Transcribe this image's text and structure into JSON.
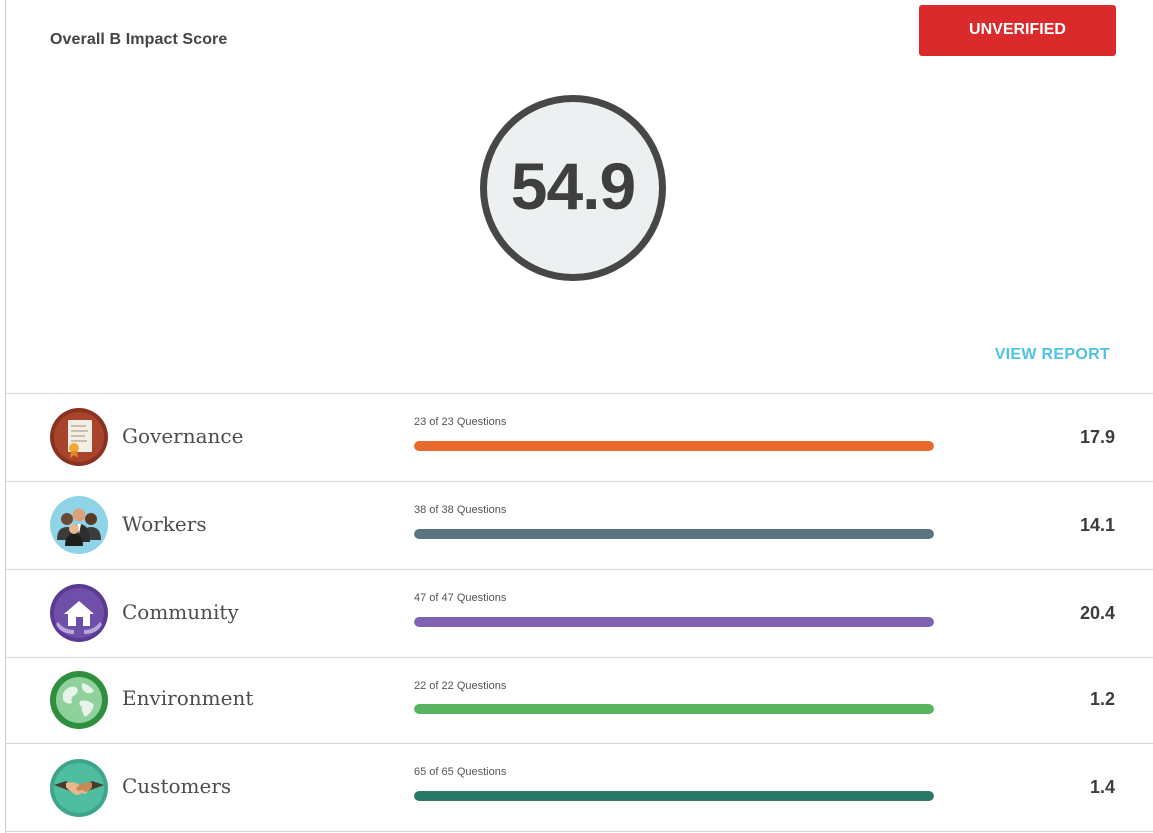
{
  "header": {
    "title": "Overall B Impact Score",
    "status_label": "UNVERIFIED",
    "status_color": "#db2a2c"
  },
  "score": {
    "value": "54.9"
  },
  "actions": {
    "view_report_label": "VIEW REPORT"
  },
  "categories": [
    {
      "name": "Governance",
      "questions": "23 of 23 Questions",
      "score": "17.9",
      "progress": 1.0,
      "bar_color": "#e8692c",
      "icon": "certificate-document-icon",
      "icon_color": "#8a3120"
    },
    {
      "name": "Workers",
      "questions": "38 of 38 Questions",
      "score": "14.1",
      "progress": 1.0,
      "bar_color": "#5a7580",
      "icon": "people-group-icon",
      "icon_color": "#8fd3e8"
    },
    {
      "name": "Community",
      "questions": "47 of 47 Questions",
      "score": "20.4",
      "progress": 1.0,
      "bar_color": "#7f63b0",
      "icon": "house-hands-icon",
      "icon_color": "#5a3b93"
    },
    {
      "name": "Environment",
      "questions": "22 of 22 Questions",
      "score": "1.2",
      "progress": 1.0,
      "bar_color": "#58b45e",
      "icon": "globe-icon",
      "icon_color": "#2f8f3f"
    },
    {
      "name": "Customers",
      "questions": "65 of 65 Questions",
      "score": "1.4",
      "progress": 1.0,
      "bar_color": "#287a65",
      "icon": "handshake-icon",
      "icon_color": "#3ea58b"
    }
  ]
}
